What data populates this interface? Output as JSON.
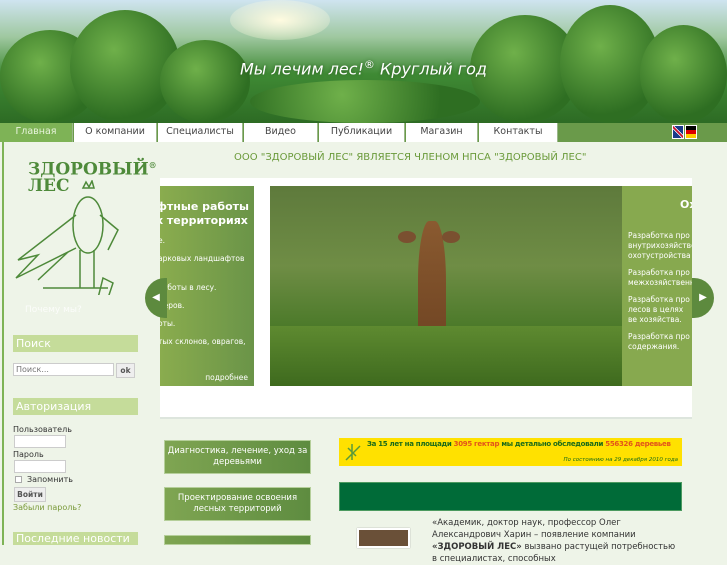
{
  "header": {
    "title": "Мы лечим лес!",
    "title_mark": "®",
    "subtitle": "Круглый год"
  },
  "nav": {
    "items": [
      {
        "label": "Главная",
        "active": true
      },
      {
        "label": "О компании"
      },
      {
        "label": "Специалисты"
      },
      {
        "label": "Видео"
      },
      {
        "label": "Публикации"
      },
      {
        "label": "Магазин"
      },
      {
        "label": "Контакты"
      }
    ],
    "languages": [
      "en",
      "de"
    ]
  },
  "logo": {
    "text_line1": "ЗДОРОВЫЙ",
    "text_line2": "ЛЕС",
    "mark": "®",
    "caption": "Почему мы?"
  },
  "membership": "ООО \"ЗДОРОВЫЙ ЛЕС\" ЯВЛЯЕТСЯ ЧЛЕНОМ НПСА \"ЗДОРОВЫЙ ЛЕС\"",
  "search": {
    "heading": "Поиск",
    "placeholder": "Поиск...",
    "button": "ok"
  },
  "auth": {
    "heading": "Авторизация",
    "user_label": "Пользователь",
    "password_label": "Пароль",
    "remember_label": "Запомнить",
    "login_button": "Войти",
    "forgot_link": "Забыли пароль?"
  },
  "news": {
    "heading": "Последние новости"
  },
  "slider": {
    "left": {
      "title1": "фтные работы",
      "title2": "х территориях",
      "lines": [
        "е.",
        "арковых ландшафтов",
        "работы в лесу.",
        "меров.",
        "оты.",
        "тых склонов, оврагов,"
      ],
      "more": "подробнее"
    },
    "right": {
      "title": "Ох",
      "items": [
        "Разработка про внутрихозяйстве охотустройства",
        "Разработка про межхозяйственн",
        "Разработка про лесов в целях ве хозяйства.",
        "Разработка про содержания."
      ]
    }
  },
  "services": [
    "Диагностика, лечение, уход за деревьями",
    "Проектирование освоения лесных территорий"
  ],
  "banner": {
    "prefix": "За 15 лет на площади",
    "area": "3095 гектар",
    "middle": "мы детально обследовали",
    "count": "556326 деревьев",
    "note": "По состоянию на 29 декабря 2010 года",
    "accent": "#e2541a"
  },
  "quote": {
    "text_before": "«Академик, доктор наук, профессор Олег Александрович Харин – появление компании",
    "company": "«ЗДОРОВЫЙ ЛЕС»",
    "text_after": "вызвано растущей потребностью в специалистах, способных"
  }
}
